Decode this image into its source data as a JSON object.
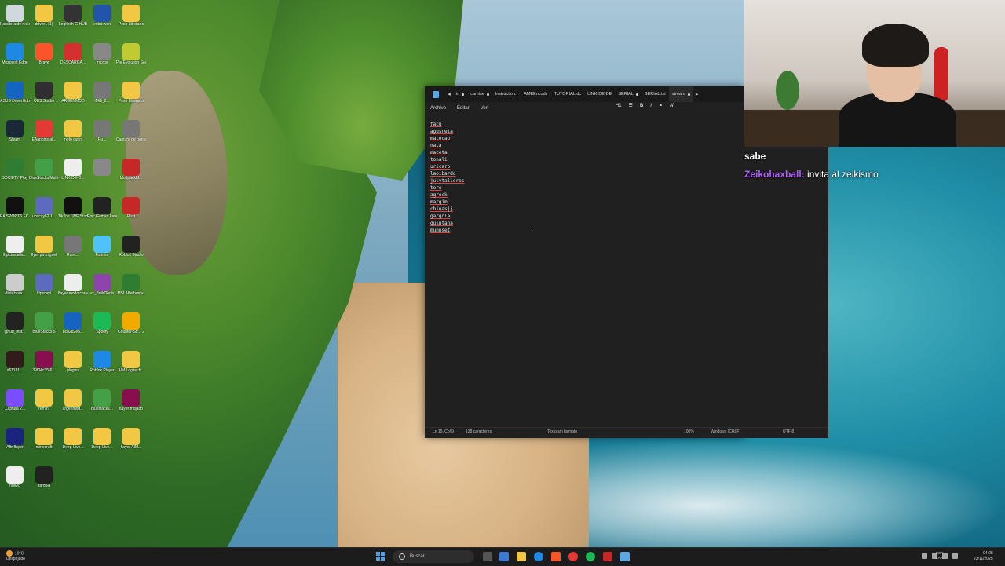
{
  "desktop": {
    "icons": [
      {
        "label": "Papelera de reciclaje",
        "color": "#cfd8dc"
      },
      {
        "label": "driver1 (1)",
        "color": "#f2c744"
      },
      {
        "label": "Logitech G HUB",
        "color": "#333333"
      },
      {
        "label": "entro.wan",
        "color": "#2255aa"
      },
      {
        "label": "Peso Liberado",
        "color": "#f2c744"
      },
      {
        "label": "Microsoft Edge",
        "color": "#1e88e5"
      },
      {
        "label": "Brave",
        "color": "#fb542b"
      },
      {
        "label": "DESCARGA...",
        "color": "#d32f2f"
      },
      {
        "label": "micros",
        "color": "#888888"
      },
      {
        "label": "Pie Evolution Soccer",
        "color": "#c0ca33"
      },
      {
        "label": "ASUS DriverHub",
        "color": "#1565c0"
      },
      {
        "label": "OBS Studio",
        "color": "#302e31"
      },
      {
        "label": "ARGENMOD",
        "color": "#f2c744"
      },
      {
        "label": "IMG_2...",
        "color": "#777777"
      },
      {
        "label": "Peso Liberado",
        "color": "#f2c744"
      },
      {
        "label": "Steam",
        "color": "#1b2838"
      },
      {
        "label": "EAappinstal...",
        "color": "#e53935"
      },
      {
        "label": "mofo cuttrs",
        "color": "#f2c744"
      },
      {
        "label": "Ru...",
        "color": "#777777"
      },
      {
        "label": "Captura de pantalla 2...",
        "color": "#777777"
      },
      {
        "label": "SOCIETY Play",
        "color": "#2e7d32"
      },
      {
        "label": "BlueStacks Multi-Insta...",
        "color": "#43a047"
      },
      {
        "label": "LINK-DE-D...",
        "color": "#eeeeee"
      },
      {
        "label": "",
        "color": "#888888"
      },
      {
        "label": "ModpackM...",
        "color": "#c62828"
      },
      {
        "label": "EA SPORTS FC 26",
        "color": "#111111"
      },
      {
        "label": "upscayl-2.1...",
        "color": "#5c6bc0"
      },
      {
        "label": "TikTok LIVE Studio",
        "color": "#111111"
      },
      {
        "label": "Epic Games Launcher",
        "color": "#222222"
      },
      {
        "label": "Rust",
        "color": "#c62828"
      },
      {
        "label": "Epicinstalla...",
        "color": "#eeeeee"
      },
      {
        "label": "flyer pa miguel",
        "color": "#f2c744"
      },
      {
        "label": "Ranc...",
        "color": "#777777"
      },
      {
        "label": "Fortnite",
        "color": "#4fc3f7"
      },
      {
        "label": "Roblox Studio",
        "color": "#222222"
      },
      {
        "label": "MisteHora...",
        "color": "#cccccc"
      },
      {
        "label": "Upscayl",
        "color": "#5c6bc0"
      },
      {
        "label": "flayer modo carrera",
        "color": "#eeeeee"
      },
      {
        "label": "vs_BuildTools",
        "color": "#8e44ad"
      },
      {
        "label": "MSI Afterburner",
        "color": "#2e7d32"
      },
      {
        "label": "lghub_inst...",
        "color": "#222222"
      },
      {
        "label": "BlueStacks 5",
        "color": "#43a047"
      },
      {
        "label": "bcb2d2e5...",
        "color": "#1565c0"
      },
      {
        "label": "Spotify",
        "color": "#1db954"
      },
      {
        "label": "Counter-Str... 2",
        "color": "#f2a900"
      },
      {
        "label": "a61131...",
        "color": "#311b1b"
      },
      {
        "label": "39f04c35-6...",
        "color": "#880e4f"
      },
      {
        "label": "plugins",
        "color": "#f2c744"
      },
      {
        "label": "Roblox Player",
        "color": "#1e88e5"
      },
      {
        "label": "AIM Logitech...",
        "color": "#f2c744"
      },
      {
        "label": "Captura 2...",
        "color": "#7c4dff"
      },
      {
        "label": "remini",
        "color": "#f2c744"
      },
      {
        "label": "argenmod...",
        "color": "#f2c744"
      },
      {
        "label": "bluestacks...",
        "color": "#43a047"
      },
      {
        "label": "flayer mojado",
        "color": "#880e4f"
      },
      {
        "label": "Aftr flayer",
        "color": "#1a237e"
      },
      {
        "label": "minecraft",
        "color": "#f2c744"
      },
      {
        "label": "Deep-Live...",
        "color": "#f2c744"
      },
      {
        "label": "Deep-Live...",
        "color": "#f2c744"
      },
      {
        "label": "flayer AIM...",
        "color": "#f2c744"
      },
      {
        "label": "nuevo",
        "color": "#eeeeee"
      },
      {
        "label": "gargola",
        "color": "#222222"
      }
    ]
  },
  "notepad": {
    "tabs": [
      {
        "label": "in",
        "modified": true
      },
      {
        "label": "camise",
        "modified": true
      },
      {
        "label": "Instruction.t",
        "modified": false
      },
      {
        "label": "AMEEncodir",
        "modified": false
      },
      {
        "label": "TUTORIAL.dc",
        "modified": false
      },
      {
        "label": "LINK-DE-DE",
        "modified": false
      },
      {
        "label": "SERIAL",
        "modified": true
      },
      {
        "label": "SERIAL.txt",
        "modified": false
      },
      {
        "label": "stream",
        "modified": true
      }
    ],
    "active_tab_index": 8,
    "menu": {
      "file": "Archivo",
      "edit": "Editar",
      "view": "Ver"
    },
    "format_tools": {
      "heading": "H1",
      "list": "☰",
      "bold": "B",
      "italic": "I",
      "link": "⚭",
      "clear": "A̸"
    },
    "lines": [
      "facu",
      "agusneta",
      "matecap",
      "nata",
      "maceta",
      "tonali",
      "uricarp",
      "laoibardo",
      "julytalleres",
      "toro",
      "agrock",
      "margim",
      "chinasjj",
      "gargola",
      "quintana",
      "munnset"
    ],
    "status": {
      "position": "Ln 15, Col 9",
      "characters": "128 caracteres",
      "format": "Texto sin formato",
      "zoom": "100%",
      "line_ending": "Windows (CRLF)",
      "encoding": "UTF-8"
    }
  },
  "chat": {
    "previous_line": "sabe",
    "username": "Zeikohaxball:",
    "message": "invita al zeikismo",
    "username_color": "#b15cff"
  },
  "taskbar": {
    "weather_temp": "19°C",
    "weather_desc": "Despejado",
    "search_placeholder": "Buscar",
    "lang_top": "ESP",
    "lang_bottom": "LAA",
    "time": "04:28",
    "date": "23/11/2025"
  }
}
